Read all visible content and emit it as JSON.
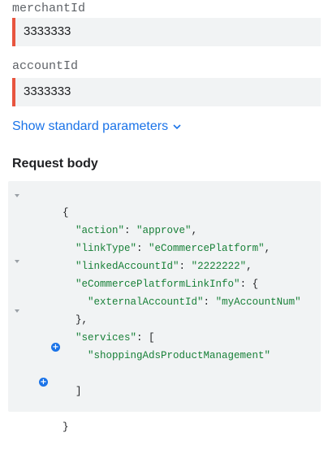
{
  "params": {
    "merchant_id": {
      "label": "merchantId",
      "value": "3333333"
    },
    "account_id": {
      "label": "accountId",
      "value": "3333333"
    }
  },
  "standard_params_link": "Show standard parameters",
  "request_body": {
    "title": "Request body",
    "open_brace": "{",
    "action_key": "\"action\"",
    "action_value": "\"approve\"",
    "link_type_key": "\"linkType\"",
    "link_type_value": "\"eCommercePlatform\"",
    "linked_account_key": "\"linkedAccountId\"",
    "linked_account_value": "\"2222222\"",
    "link_info_key": "\"eCommercePlatformLinkInfo\"",
    "external_account_key": "\"externalAccountId\"",
    "external_account_value": "\"myAccountNum\"",
    "close_inner": "},",
    "services_key": "\"services\"",
    "services_item": "\"shoppingAdsProductManagement\"",
    "close_array": "]",
    "close_brace": "}"
  },
  "icons": {
    "chevron": "chevron-down-icon",
    "fold": "fold-triangle-icon",
    "add": "add-circle-icon"
  },
  "colors": {
    "required_marker": "#e8553f",
    "link": "#1a73e8",
    "json_text": "#188038",
    "field_bg": "#f1f3f4"
  }
}
